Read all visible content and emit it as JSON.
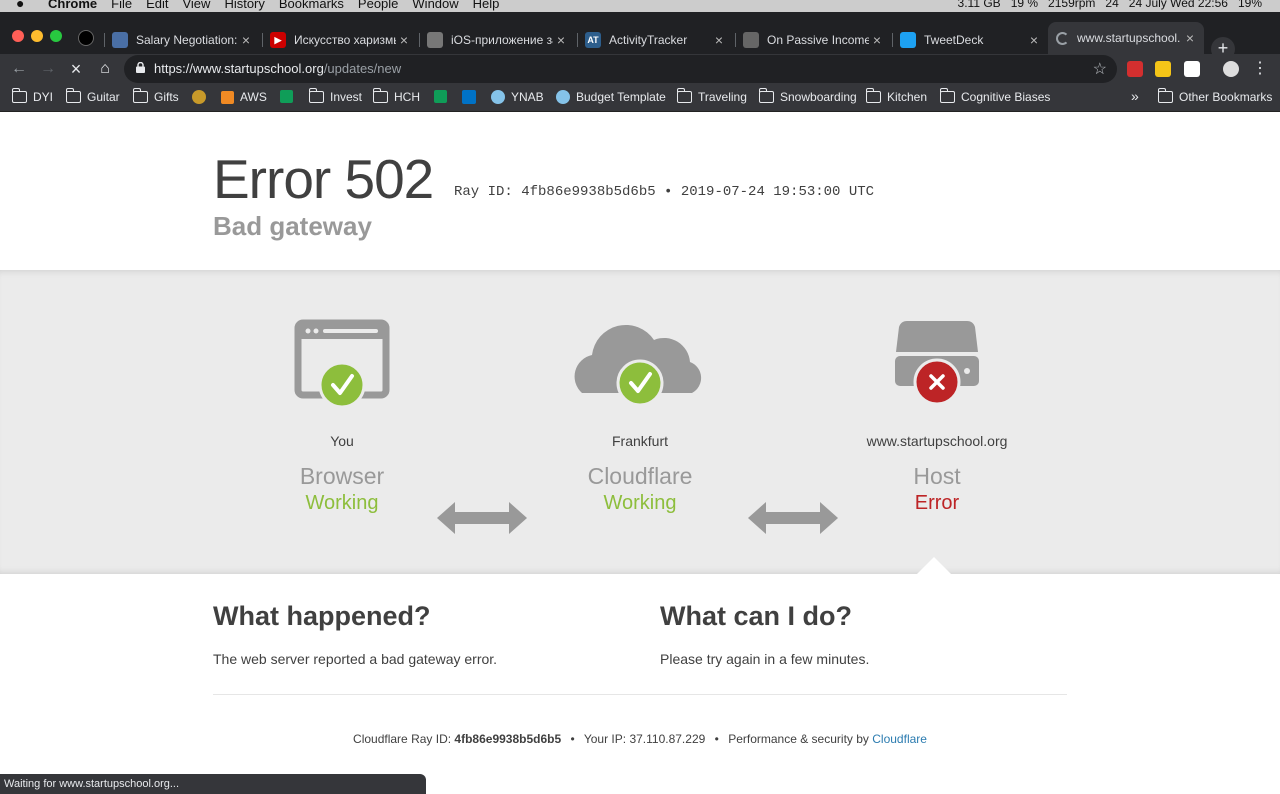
{
  "menubar": {
    "apple": "",
    "items": [
      "Chrome",
      "File",
      "Edit",
      "View",
      "History",
      "Bookmarks",
      "People",
      "Window",
      "Help"
    ],
    "status": {
      "memory": "3.11 GB",
      "cpu": "19 %",
      "fan": "2159rpm",
      "calendar_day": "24",
      "datetime": "24 July Wed 22:56",
      "battery": "19%"
    }
  },
  "tabs": [
    {
      "label": "Salary Negotiation:",
      "favicon": "salary-tab-icon",
      "color": "#4a6fa5"
    },
    {
      "label": "Искусство харизмы",
      "favicon": "youtube-icon",
      "color": "#cc0000"
    },
    {
      "label": "iOS-приложение за",
      "favicon": "document-icon",
      "color": "#777777"
    },
    {
      "label": "ActivityTracker",
      "favicon": "activitytracker-icon",
      "color": "#2d5e8c"
    },
    {
      "label": "On Passive Income",
      "favicon": "page-icon",
      "color": "#666666"
    },
    {
      "label": "TweetDeck",
      "favicon": "tweetdeck-icon",
      "color": "#1da1f2"
    },
    {
      "label": "www.startupschool.",
      "favicon": "loading-icon",
      "color": "#9aa0a6"
    }
  ],
  "toolbar": {
    "url_host": "https://www.startupschool.org",
    "url_path": "/updates/new"
  },
  "bookmarks": [
    {
      "label": "DYI",
      "icon": "folder-icon"
    },
    {
      "label": "Guitar",
      "icon": "folder-icon"
    },
    {
      "label": "Gifts",
      "icon": "folder-icon"
    },
    {
      "label": "",
      "icon": "wow-icon"
    },
    {
      "label": "AWS",
      "icon": "aws-icon"
    },
    {
      "label": "",
      "icon": "sheets-icon"
    },
    {
      "label": "Invest",
      "icon": "folder-icon"
    },
    {
      "label": "HCH",
      "icon": "folder-icon"
    },
    {
      "label": "",
      "icon": "sheets-icon"
    },
    {
      "label": "",
      "icon": "outlook-icon"
    },
    {
      "label": "YNAB",
      "icon": "ynab-icon"
    },
    {
      "label": "Budget Template",
      "icon": "ynab-icon"
    },
    {
      "label": "Traveling",
      "icon": "folder-icon"
    },
    {
      "label": "Snowboarding",
      "icon": "folder-icon"
    },
    {
      "label": "Kitchen",
      "icon": "folder-icon"
    },
    {
      "label": "Cognitive Biases",
      "icon": "folder-icon"
    }
  ],
  "bookmarks_more": "»",
  "other_bookmarks": "Other Bookmarks",
  "error": {
    "title": "Error 502",
    "ray_line": "Ray ID: 4fb86e9938b5d6b5 • 2019-07-24 19:53:00 UTC",
    "subtitle": "Bad gateway"
  },
  "nodes": [
    {
      "place": "You",
      "kind": "Browser",
      "state": "Working",
      "ok": true
    },
    {
      "place": "Frankfurt",
      "kind": "Cloudflare",
      "state": "Working",
      "ok": true
    },
    {
      "place": "www.startupschool.org",
      "kind": "Host",
      "state": "Error",
      "ok": false
    }
  ],
  "colors": {
    "ok": "#8dbe3c",
    "error": "#bd2426",
    "icon_gray": "#999999",
    "link": "#2c7cb0"
  },
  "what_happened": {
    "title": "What happened?",
    "text": "The web server reported a bad gateway error."
  },
  "what_can_i_do": {
    "title": "What can I do?",
    "text": "Please try again in a few minutes."
  },
  "footer": {
    "ray_label": "Cloudflare Ray ID:",
    "ray_id": "4fb86e9938b5d6b5",
    "ip_label": "Your IP:",
    "ip": "37.110.87.229",
    "perf_label": "Performance & security by",
    "perf_link": "Cloudflare",
    "separator": "•"
  },
  "status_bubble": "Waiting for www.startupschool.org..."
}
